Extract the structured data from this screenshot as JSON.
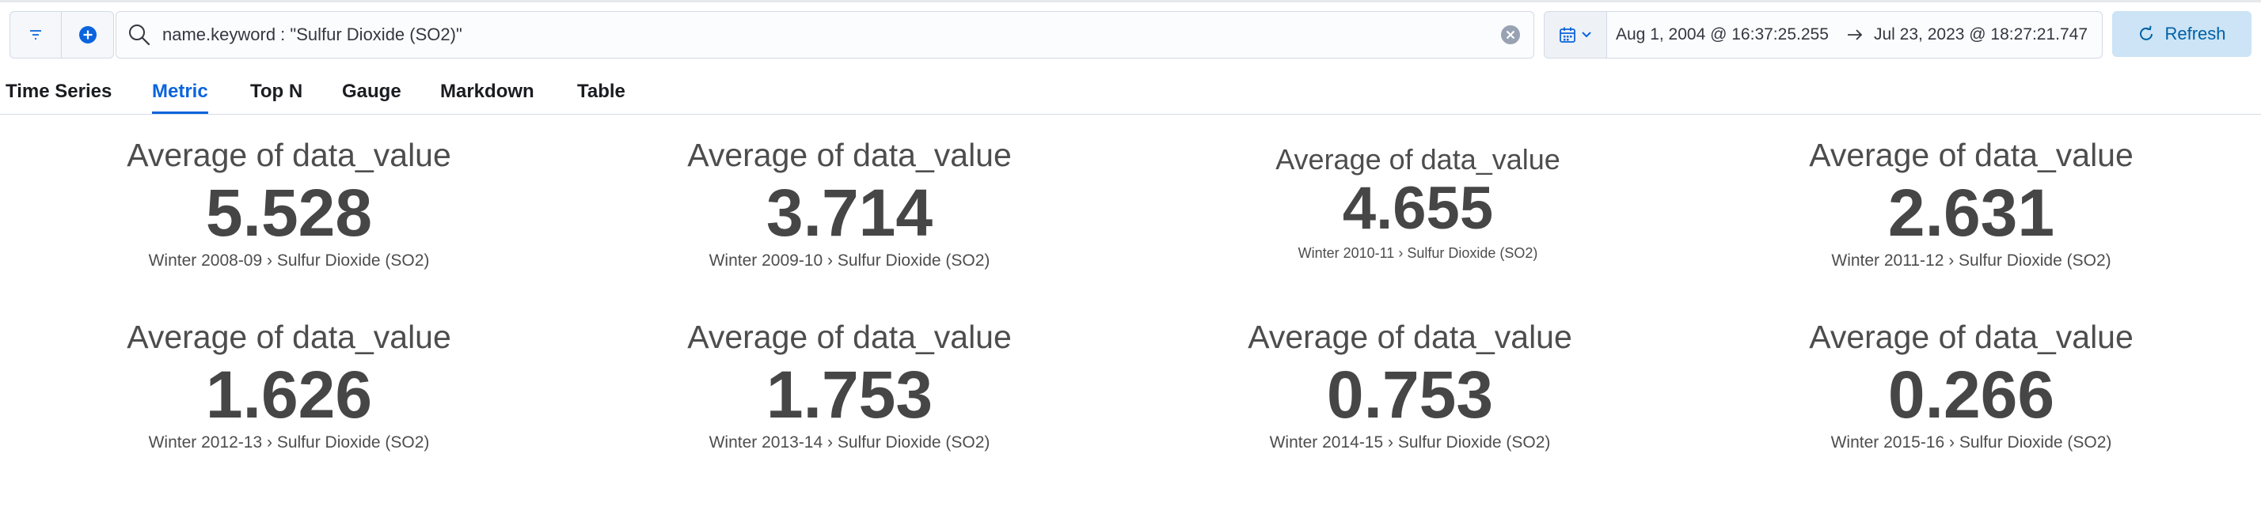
{
  "query_bar": {
    "query": "name.keyword : \"Sulfur Dioxide (SO2)\"",
    "date_start": "Aug 1, 2004 @ 16:37:25.255",
    "date_end": "Jul 23, 2023 @ 18:27:21.747",
    "refresh_label": "Refresh"
  },
  "tabs": [
    {
      "label": "Time Series"
    },
    {
      "label": "Metric"
    },
    {
      "label": "Top N"
    },
    {
      "label": "Gauge"
    },
    {
      "label": "Markdown"
    },
    {
      "label": "Table"
    }
  ],
  "active_tab": "Metric",
  "metrics": [
    {
      "title": "Average of data_value",
      "value": "5.528",
      "subtitle": "Winter 2008-09 › Sulfur Dioxide (SO2)"
    },
    {
      "title": "Average of data_value",
      "value": "3.714",
      "subtitle": "Winter 2009-10 › Sulfur Dioxide (SO2)"
    },
    {
      "title": "Average of data_value",
      "value": "4.655",
      "subtitle": "Winter 2010-11 › Sulfur Dioxide (SO2)"
    },
    {
      "title": "Average of data_value",
      "value": "2.631",
      "subtitle": "Winter 2011-12 › Sulfur Dioxide (SO2)"
    },
    {
      "title": "Average of data_value",
      "value": "1.626",
      "subtitle": "Winter 2012-13 › Sulfur Dioxide (SO2)"
    },
    {
      "title": "Average of data_value",
      "value": "1.753",
      "subtitle": "Winter 2013-14 › Sulfur Dioxide (SO2)"
    },
    {
      "title": "Average of data_value",
      "value": "0.753",
      "subtitle": "Winter 2014-15 › Sulfur Dioxide (SO2)"
    },
    {
      "title": "Average of data_value",
      "value": "0.266",
      "subtitle": "Winter 2015-16 › Sulfur Dioxide (SO2)"
    }
  ],
  "colors": {
    "accent": "#0b64dd",
    "refresh_bg": "#cce4f5",
    "refresh_text": "#0061a6",
    "metric_text": "#464646"
  },
  "icons": [
    "filter-icon",
    "plus-circle-icon",
    "search-icon",
    "clear-icon",
    "calendar-icon",
    "chevron-down-icon",
    "arrow-right-icon",
    "refresh-icon"
  ]
}
